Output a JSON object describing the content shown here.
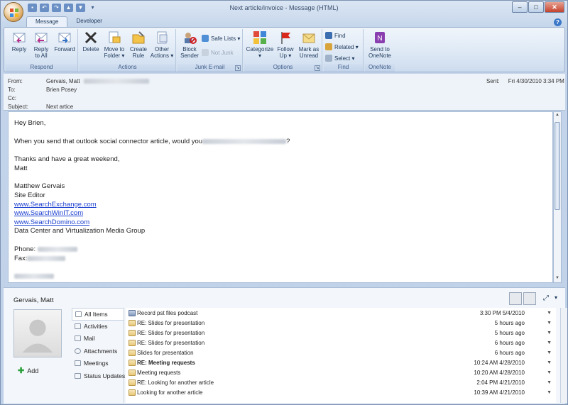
{
  "window": {
    "title": "Next article/invoice - Message (HTML)",
    "controls": {
      "minimize": "–",
      "maximize": "□",
      "close": "✕"
    }
  },
  "tabs": [
    {
      "label": "Message",
      "active": true
    },
    {
      "label": "Developer",
      "active": false
    }
  ],
  "ribbon": {
    "respond": {
      "label": "Respond",
      "buttons": [
        {
          "line1": "Reply",
          "line2": ""
        },
        {
          "line1": "Reply",
          "line2": "to All"
        },
        {
          "line1": "Forward",
          "line2": ""
        }
      ]
    },
    "actions": {
      "label": "Actions",
      "buttons": [
        {
          "line1": "Delete",
          "line2": ""
        },
        {
          "line1": "Move to",
          "line2": "Folder ▾"
        },
        {
          "line1": "Create",
          "line2": "Rule"
        },
        {
          "line1": "Other",
          "line2": "Actions ▾"
        }
      ]
    },
    "junk": {
      "label": "Junk E-mail",
      "block_line1": "Block",
      "block_line2": "Sender",
      "safe_lists": "Safe Lists ▾",
      "not_junk": "Not Junk"
    },
    "options": {
      "label": "Options",
      "buttons": [
        {
          "line1": "Categorize",
          "line2": "▾"
        },
        {
          "line1": "Follow",
          "line2": "Up ▾"
        },
        {
          "line1": "Mark as",
          "line2": "Unread"
        }
      ]
    },
    "find": {
      "label": "Find",
      "find": "Find",
      "related": "Related ▾",
      "select": "Select ▾"
    },
    "onenote": {
      "label": "OneNote",
      "line1": "Send to",
      "line2": "OneNote"
    }
  },
  "header": {
    "from_label": "From:",
    "from_value": "Gervais, Matt",
    "to_label": "To:",
    "to_value": "Brien Posey",
    "cc_label": "Cc:",
    "subject_label": "Subject:",
    "subject_value": "Next artice",
    "sent_label": "Sent:",
    "sent_value": "Fri 4/30/2010 3:34 PM"
  },
  "body": {
    "greeting": "Hey Brien,",
    "line1": "When you send that outlook social connector article, would you",
    "line1_end": "?",
    "thanks": "Thanks and have a great weekend,",
    "sign_short": "Matt",
    "sig_name": "Matthew Gervais",
    "sig_title": "Site Editor",
    "link1": "www.SearchExchange.com",
    "link2": "www.SearchWinIT.com",
    "link3": "www.SearchDomino.com",
    "group": "Data Center and Virtualization Media Group",
    "phone_label": "Phone:",
    "fax_label": "Fax:"
  },
  "people_pane": {
    "name": "Gervais, Matt",
    "add_label": "Add",
    "nav": [
      {
        "label": "All Items",
        "selected": true
      },
      {
        "label": "Activities",
        "selected": false
      },
      {
        "label": "Mail",
        "selected": false
      },
      {
        "label": "Attachments",
        "selected": false
      },
      {
        "label": "Meetings",
        "selected": false
      },
      {
        "label": "Status Updates",
        "selected": false
      }
    ],
    "items": [
      {
        "subject": "Record pst files podcast",
        "time": "3:30 PM  5/4/2010",
        "bold": false
      },
      {
        "subject": "RE: Slides for presentation",
        "time": "5 hours ago",
        "bold": false
      },
      {
        "subject": "RE: Slides for presentation",
        "time": "5 hours ago",
        "bold": false
      },
      {
        "subject": "RE: Slides for presentation",
        "time": "6 hours ago",
        "bold": false
      },
      {
        "subject": "Slides for presentation",
        "time": "6 hours ago",
        "bold": false
      },
      {
        "subject": "RE: Meeting requests",
        "time": "10:24 AM  4/28/2010",
        "bold": true
      },
      {
        "subject": "Meeting requests",
        "time": "10:20 AM  4/28/2010",
        "bold": false
      },
      {
        "subject": "RE: Looking for another article",
        "time": "2:04 PM  4/21/2010",
        "bold": false
      },
      {
        "subject": "Looking for another article",
        "time": "10:39 AM  4/21/2010",
        "bold": false
      }
    ]
  },
  "colors": {
    "accent": "#1e395b",
    "link": "#1a3ecf"
  }
}
